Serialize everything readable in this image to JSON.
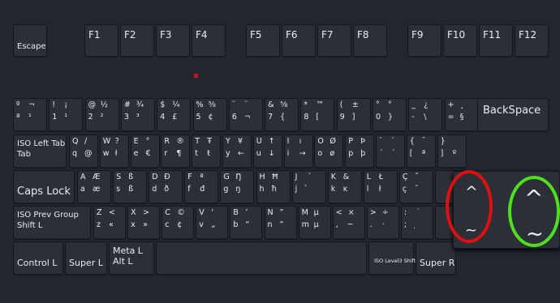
{
  "function_row": [
    "Escape",
    "F1",
    "F2",
    "F3",
    "F4",
    "F5",
    "F6",
    "F7",
    "F8",
    "F9",
    "F10",
    "F11",
    "F12"
  ],
  "number_row": [
    [
      "º",
      "¬",
      "ª",
      "¹"
    ],
    [
      "!",
      "¡",
      "1",
      "¹"
    ],
    [
      "@",
      "½",
      "2",
      "²"
    ],
    [
      "#",
      "¾",
      "3",
      "³"
    ],
    [
      "$",
      "¼",
      "4",
      "£"
    ],
    [
      "%",
      "⅜",
      "5",
      "¢"
    ],
    [
      "¨",
      "¨",
      "6",
      "¬"
    ],
    [
      "&",
      "⅝",
      "7",
      "{"
    ],
    [
      "*",
      "™",
      "8",
      "["
    ],
    [
      "(",
      "±",
      "9",
      "]"
    ],
    [
      "°",
      "°",
      "0",
      "}"
    ],
    [
      "_",
      "¿",
      "-",
      "\\"
    ],
    [
      "+",
      "¸",
      "=",
      "§"
    ]
  ],
  "backspace": "BackSpace",
  "tab_label": "ISO Left Tab\nTab",
  "q_row": [
    [
      "Q",
      "/",
      "q",
      "@"
    ],
    [
      "W",
      "?",
      "w",
      "ł"
    ],
    [
      "E",
      "°",
      "e",
      "€"
    ],
    [
      "R",
      "®",
      "r",
      "¶"
    ],
    [
      "T",
      "Ŧ",
      "t",
      "ŧ"
    ],
    [
      "Y",
      "¥",
      "y",
      "←"
    ],
    [
      "U",
      "↑",
      "u",
      "↓"
    ],
    [
      "I",
      "ı",
      "i",
      "→"
    ],
    [
      "O",
      "Ø",
      "o",
      "ø"
    ],
    [
      "P",
      "Þ",
      "p",
      "þ"
    ],
    [
      "`",
      "`",
      "´",
      "´"
    ],
    [
      "{",
      "¯",
      "[",
      "ª"
    ],
    [
      "}",
      "",
      "]",
      "º"
    ]
  ],
  "caps_label": "Caps Lock",
  "a_row": [
    [
      "A",
      "Æ",
      "a",
      "æ"
    ],
    [
      "S",
      "ß",
      "s",
      "ß"
    ],
    [
      "D",
      "Ð",
      "d",
      "ð"
    ],
    [
      "F",
      "ª",
      "f",
      "đ"
    ],
    [
      "G",
      "Ŋ",
      "g",
      "ŋ"
    ],
    [
      "H",
      "Ħ",
      "h",
      "ħ"
    ],
    [
      "J",
      "´",
      "j",
      "̉"
    ],
    [
      "K",
      "&",
      "k",
      "ĸ"
    ],
    [
      "L",
      "Ł",
      "l",
      "ł"
    ],
    [
      "Ç",
      "˝",
      "ç",
      "˘"
    ]
  ],
  "shift_label": "ISO Prev Group\nShift L",
  "z_row": [
    [
      "Z",
      "<",
      "z",
      "«"
    ],
    [
      "X",
      ">",
      "x",
      "»"
    ],
    [
      "C",
      "©",
      "c",
      "¢"
    ],
    [
      "V",
      "‘",
      "v",
      "„"
    ],
    [
      "B",
      "’",
      "b",
      "“"
    ],
    [
      "N",
      "”",
      "n",
      "”"
    ],
    [
      "M",
      "µ",
      "m",
      "µ"
    ],
    [
      "<",
      "×",
      ",",
      "─"
    ],
    [
      ">",
      "÷",
      ".",
      "·"
    ],
    [
      ":",
      "˙",
      ";",
      "̣"
    ]
  ],
  "bottom_row": [
    "Control L",
    "Super L",
    "Meta L\nAlt L",
    "",
    "ISO Level3 Shift",
    "Super R"
  ],
  "popup": {
    "top_symbol": "^",
    "top_bottom_symbol": "~",
    "caret": "^",
    "tilde": "~"
  },
  "colors": {
    "background": "#23262f",
    "key": "#2c2f38",
    "highlight_red": "#e01010",
    "highlight_green": "#4de01c"
  }
}
